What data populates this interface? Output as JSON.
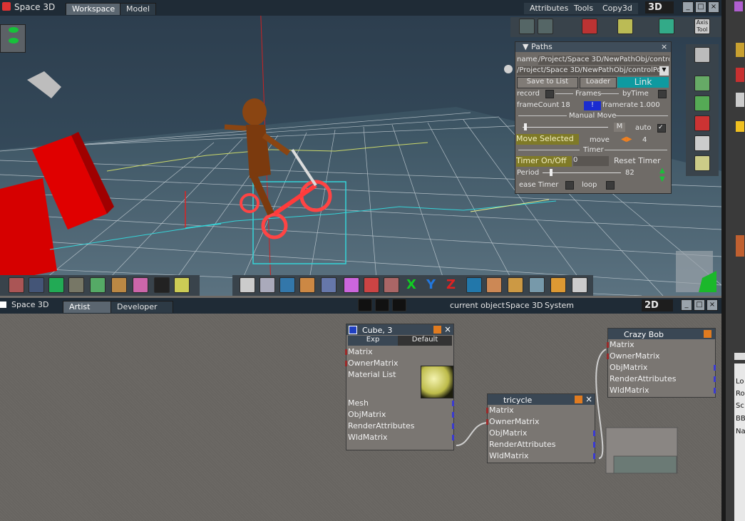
{
  "app": {
    "title": "Space 3D"
  },
  "top_tabs": [
    "Workspace",
    "Model"
  ],
  "top_menu": {
    "attributes": "Attributes",
    "tools": "Tools",
    "copy3d": "Copy3d",
    "mode": "3D"
  },
  "paths_panel": {
    "title": "Paths",
    "name_label": "name",
    "name_value": "/Project/Space 3D/NewPathObj/contro",
    "path_value": "/Project/Space 3D/NewPathObj/controlPo",
    "save_to_list": "Save to List",
    "loader": "Loader",
    "link": "Link",
    "record": "record",
    "frames": "Frames",
    "bytime": "byTime",
    "framecount_label": "frameCount",
    "framecount_value": "18",
    "framerate_label": "framerate",
    "framerate_value": "1.000",
    "manual_move": "Manual Move",
    "m_label": "M",
    "auto_label": "auto",
    "move_selected": "Move Selected",
    "move_label": "move",
    "move_value": "4",
    "timer": "Timer",
    "timer_onoff": "Timer On/Off",
    "timer_value": "0",
    "reset_timer": "Reset Timer",
    "period_label": "Period",
    "period_value": "82",
    "ease_timer": "ease Timer",
    "loop": "loop"
  },
  "bottom_bar": {
    "app": "Space 3D",
    "tabs": [
      "Artist",
      "Developer"
    ],
    "current_object": "current object",
    "space3d": "Space 3D",
    "system": "System",
    "mode": "2D"
  },
  "nodes": {
    "cube": {
      "title": "Cube, 3",
      "tabs": [
        "Exp",
        "Default"
      ],
      "inputs": [
        "Matrix",
        "OwnerMatrix",
        "Material List"
      ],
      "outputs": [
        "Mesh",
        "ObjMatrix",
        "RenderAttributes",
        "WldMatrix"
      ]
    },
    "tricycle": {
      "title": "tricycle",
      "ports": [
        "Matrix",
        "OwnerMatrix",
        "ObjMatrix",
        "RenderAttributes",
        "WldMatrix"
      ]
    },
    "crazybob": {
      "title": "Crazy Bob",
      "ports": [
        "Matrix",
        "OwnerMatrix",
        "ObjMatrix",
        "RenderAttributes",
        "WldMatrix"
      ]
    }
  },
  "right_side_labels": [
    "Lo",
    "Ro",
    "Sc",
    "BB",
    "Na"
  ],
  "colors": {
    "link_button": "#0e9aa0",
    "blue_field": "#1a2cd0",
    "highlight_yellow": "#7f7a27"
  }
}
